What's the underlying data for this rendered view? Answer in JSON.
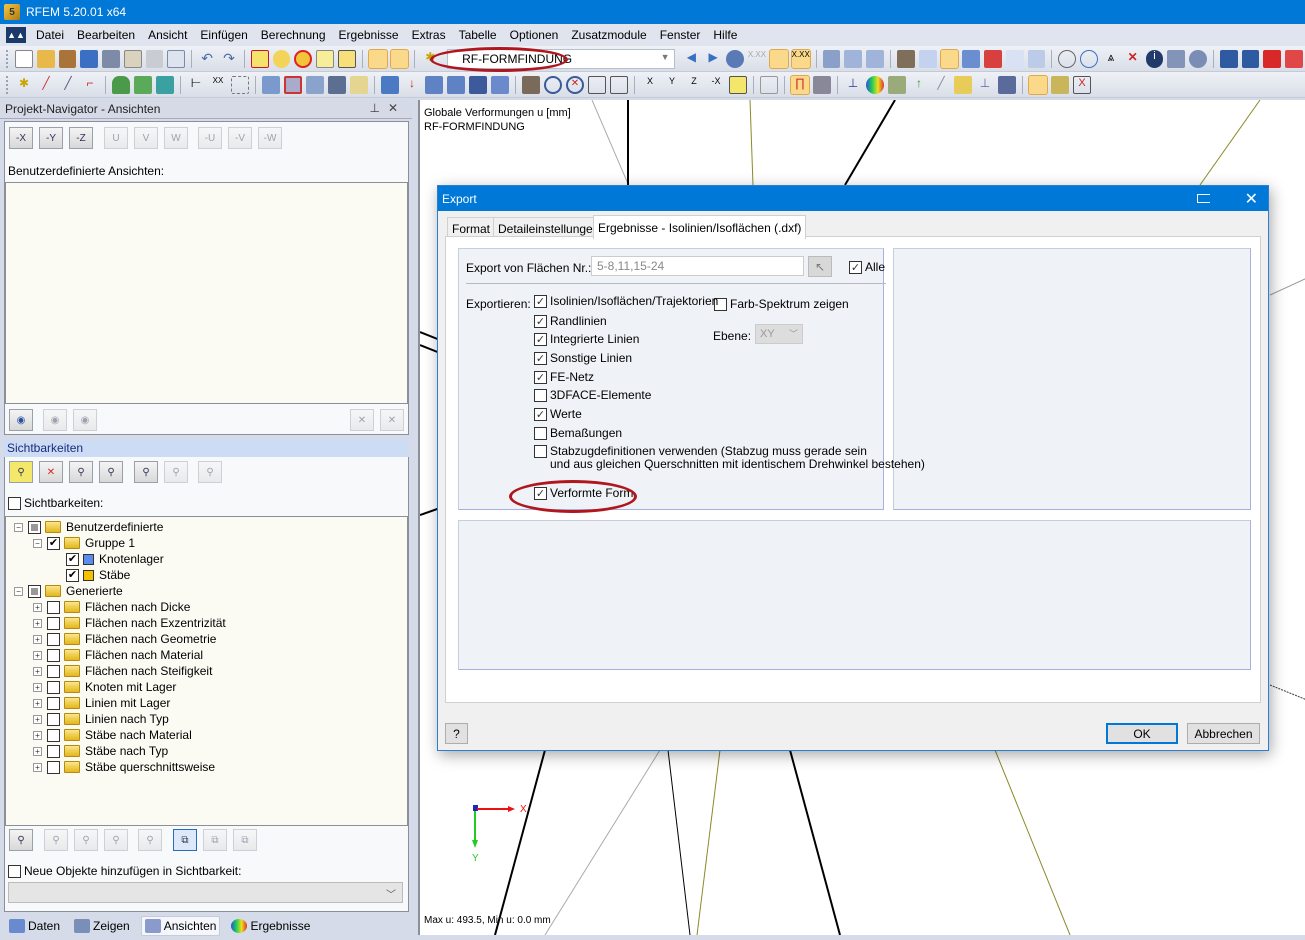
{
  "app": {
    "title": "RFEM 5.20.01 x64"
  },
  "menu": [
    "Datei",
    "Bearbeiten",
    "Ansicht",
    "Einfügen",
    "Berechnung",
    "Ergebnisse",
    "Extras",
    "Tabelle",
    "Optionen",
    "Zusatzmodule",
    "Fenster",
    "Hilfe"
  ],
  "toolbar": {
    "loadcase_combo": "RF-FORMFINDUNG",
    "row1_icons": [
      "new-file-icon",
      "open-file-icon",
      "archive-icon",
      "database-icon",
      "save-icon",
      "clipboard-icon",
      "print-icon",
      "print-preview-icon",
      "undo-icon",
      "redo-icon",
      "surface-icon",
      "select-node-icon",
      "target-icon",
      "add-select-icon",
      "window-icon",
      "table-view-icon",
      "table-grid-icon"
    ],
    "row1_right_icons": [
      "previous-icon",
      "next-icon",
      "show-results-icon",
      "values-icon",
      "results-on-icon",
      "values-on-icon",
      "member-icon",
      "bar-chart-icon",
      "bar-chart2-icon",
      "hand-icon",
      "grid-icon",
      "view-toggle-icon",
      "view-x-icon",
      "view-y-icon",
      "grid2-icon",
      "section-icon",
      "rotate-icon",
      "rotate2-icon",
      "mirror-icon",
      "delete-node-icon",
      "info-icon",
      "settings-icon",
      "gears-icon",
      "support-icon",
      "support2-icon",
      "load-icon",
      "load2-icon"
    ],
    "row2_icons": [
      "node-icon",
      "line-icon",
      "member-icon",
      "polyline-icon",
      "support-node-icon",
      "support-nodes-icon",
      "surface-icon",
      "dimension-icon",
      "text-icon",
      "frame-icon",
      "solid-icon",
      "opening-icon",
      "view-icon",
      "box-icon",
      "copy-icon",
      "move-icon",
      "load-node-icon",
      "load-member-icon",
      "load-line-icon",
      "load-surface-icon",
      "load-solid-icon",
      "zoom-icon",
      "zoom-window-icon",
      "zoom-x-icon",
      "iso-view-icon",
      "3d-view-icon",
      "view-x-axis-icon",
      "view-y-axis-icon",
      "view-z-axis-icon",
      "view-neg-x-icon",
      "visibility-icon",
      "color-icon",
      "frame-deform-icon",
      "animation-icon",
      "results-icon",
      "isoline-icon",
      "solid-result-icon",
      "arrow-icon",
      "section-result-icon",
      "panel-icon",
      "diagram-icon",
      "table-icon",
      "panel-toggle-icon",
      "tools-icon",
      "close-results-icon"
    ]
  },
  "navigator": {
    "title": "Projekt-Navigator - Ansichten",
    "view_buttons": [
      "-X",
      "-Y",
      "-Z",
      "U",
      "V",
      "W",
      "-U",
      "-V",
      "-W"
    ],
    "custom_views_label": "Benutzerdefinierte Ansichten:",
    "visibility_header": "Sichtbarkeiten",
    "visibility_checkbox": "Sichtbarkeiten:",
    "tree": [
      {
        "label": "Benutzerdefinierte",
        "level": 0,
        "state": "indeterminate",
        "expanded": true,
        "icon": "folder"
      },
      {
        "label": "Gruppe 1",
        "level": 1,
        "state": "checked",
        "expanded": true,
        "icon": "folder"
      },
      {
        "label": "Knotenlager",
        "level": 2,
        "state": "checked",
        "icon": "swatch",
        "color": "#5b8def"
      },
      {
        "label": "Stäbe",
        "level": 2,
        "state": "checked",
        "icon": "swatch",
        "color": "#f5c000"
      },
      {
        "label": "Generierte",
        "level": 0,
        "state": "indeterminate",
        "expanded": true,
        "icon": "folder"
      },
      {
        "label": "Flächen nach Dicke",
        "level": 1,
        "state": "unchecked",
        "expanded": false,
        "icon": "folder"
      },
      {
        "label": "Flächen nach Exzentrizität",
        "level": 1,
        "state": "unchecked",
        "expanded": false,
        "icon": "folder"
      },
      {
        "label": "Flächen nach Geometrie",
        "level": 1,
        "state": "unchecked",
        "expanded": false,
        "icon": "folder"
      },
      {
        "label": "Flächen nach Material",
        "level": 1,
        "state": "unchecked",
        "expanded": false,
        "icon": "folder"
      },
      {
        "label": "Flächen nach Steifigkeit",
        "level": 1,
        "state": "unchecked",
        "expanded": false,
        "icon": "folder"
      },
      {
        "label": "Knoten mit Lager",
        "level": 1,
        "state": "unchecked",
        "expanded": false,
        "icon": "folder"
      },
      {
        "label": "Linien mit Lager",
        "level": 1,
        "state": "unchecked",
        "expanded": false,
        "icon": "folder"
      },
      {
        "label": "Linien nach Typ",
        "level": 1,
        "state": "unchecked",
        "expanded": false,
        "icon": "folder"
      },
      {
        "label": "Stäbe nach Material",
        "level": 1,
        "state": "unchecked",
        "expanded": false,
        "icon": "folder"
      },
      {
        "label": "Stäbe nach Typ",
        "level": 1,
        "state": "unchecked",
        "expanded": false,
        "icon": "folder"
      },
      {
        "label": "Stäbe querschnittsweise",
        "level": 1,
        "state": "unchecked",
        "expanded": false,
        "icon": "folder"
      }
    ],
    "new_objects_checkbox": "Neue Objekte hinzufügen in Sichtbarkeit:",
    "new_objects_select": "",
    "tabs": [
      {
        "label": "Daten",
        "icon": "data-icon",
        "active": false
      },
      {
        "label": "Zeigen",
        "icon": "display-icon",
        "active": false
      },
      {
        "label": "Ansichten",
        "icon": "views-icon",
        "active": true
      },
      {
        "label": "Ergebnisse",
        "icon": "results-icon",
        "active": false
      }
    ]
  },
  "viewport": {
    "title_line1": "Globale Verformungen u [mm]",
    "title_line2": "RF-FORMFINDUNG",
    "axis_x": "X",
    "axis_y": "Y",
    "status": "Max u: 493.5, Min u: 0.0 mm"
  },
  "dialog": {
    "title": "Export",
    "tabs": [
      {
        "label": "Format",
        "active": false
      },
      {
        "label": "Detaileinstellungen",
        "active": false
      },
      {
        "label": "Ergebnisse - Isolinien/Isoflächen (.dxf)",
        "active": true
      }
    ],
    "surfaces_label": "Export von Flächen Nr.:",
    "surfaces_value": "5-8,11,15-24",
    "all_label": "Alle",
    "all_checked": true,
    "export_label": "Exportieren:",
    "export_options": [
      {
        "label": "Isolinien/Isoflächen/Trajektorien",
        "checked": true
      },
      {
        "label": "Randlinien",
        "checked": true
      },
      {
        "label": "Integrierte Linien",
        "checked": true
      },
      {
        "label": "Sonstige Linien",
        "checked": true
      },
      {
        "label": "FE-Netz",
        "checked": true
      },
      {
        "label": "3DFACE-Elemente",
        "checked": false
      },
      {
        "label": "Werte",
        "checked": true
      },
      {
        "label": "Bemaßungen",
        "checked": false
      },
      {
        "label": "Stabzugdefinitionen verwenden (Stabzug muss gerade sein\nund aus gleichen Querschnitten mit identischem Drehwinkel bestehen)",
        "checked": false
      },
      {
        "label": "Verformte Form",
        "checked": true
      }
    ],
    "color_spectrum_label": "Farb-Spektrum zeigen",
    "color_spectrum_checked": false,
    "plane_label": "Ebene:",
    "plane_value": "XY",
    "ok_label": "OK",
    "cancel_label": "Abbrechen"
  },
  "colors": {
    "accent": "#0078d7",
    "highlight": "#b0161d"
  }
}
